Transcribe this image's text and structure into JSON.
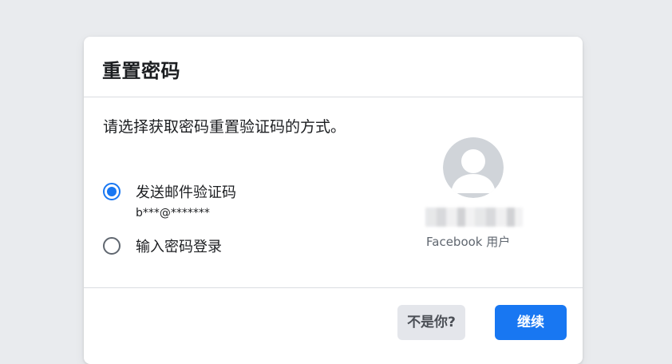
{
  "dialog": {
    "title": "重置密码",
    "instruction": "请选择获取密码重置验证码的方式。",
    "options": [
      {
        "label": "发送邮件验证码",
        "sub": "b***@*******",
        "selected": true
      },
      {
        "label": "输入密码登录",
        "selected": false
      }
    ],
    "profile": {
      "label": "Facebook 用户"
    },
    "buttons": {
      "not_you": "不是你?",
      "continue": "继续"
    }
  },
  "colors": {
    "accent": "#1877f2",
    "page_background": "#e9ebee",
    "secondary_button": "#e4e6eb"
  },
  "icons": {
    "avatar": "default-user-silhouette-icon"
  }
}
